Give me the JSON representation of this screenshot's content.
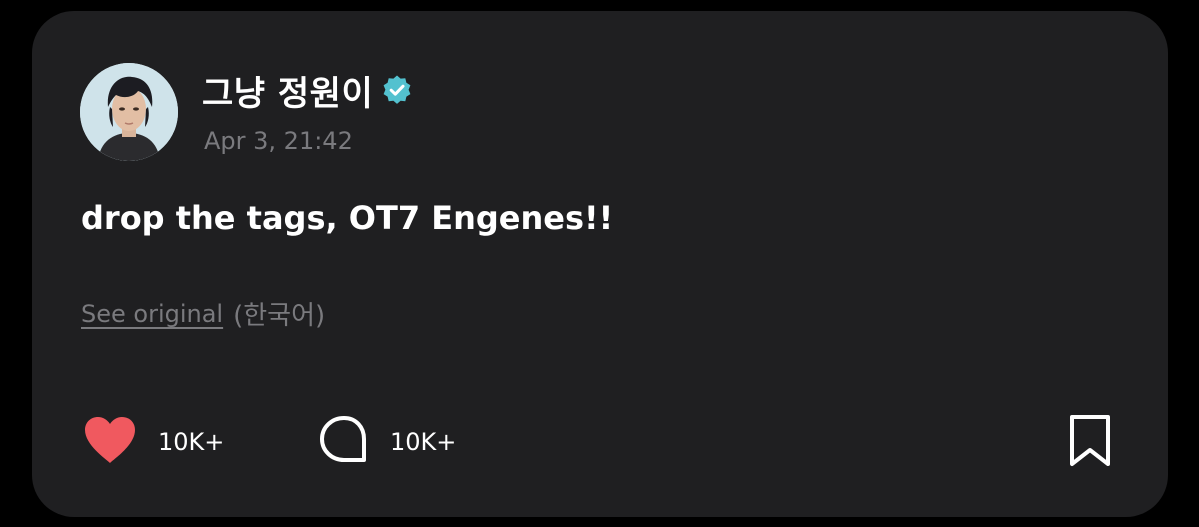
{
  "post": {
    "username": "그냥 정원이",
    "timestamp": "Apr 3, 21:42",
    "text": "drop the tags, OT7 Engenes!!",
    "see_original_label": "See original",
    "original_language": "(한국어)"
  },
  "actions": {
    "like_count": "10K+",
    "comment_count": "10K+"
  },
  "colors": {
    "background": "#000000",
    "card": "#1f1f21",
    "like": "#f0595f",
    "verified": "#53c1cf",
    "muted_text": "#7a7a7e"
  },
  "icons": {
    "verified": "verified-badge-icon",
    "like": "heart-icon",
    "comment": "comment-bubble-icon",
    "bookmark": "bookmark-icon"
  }
}
